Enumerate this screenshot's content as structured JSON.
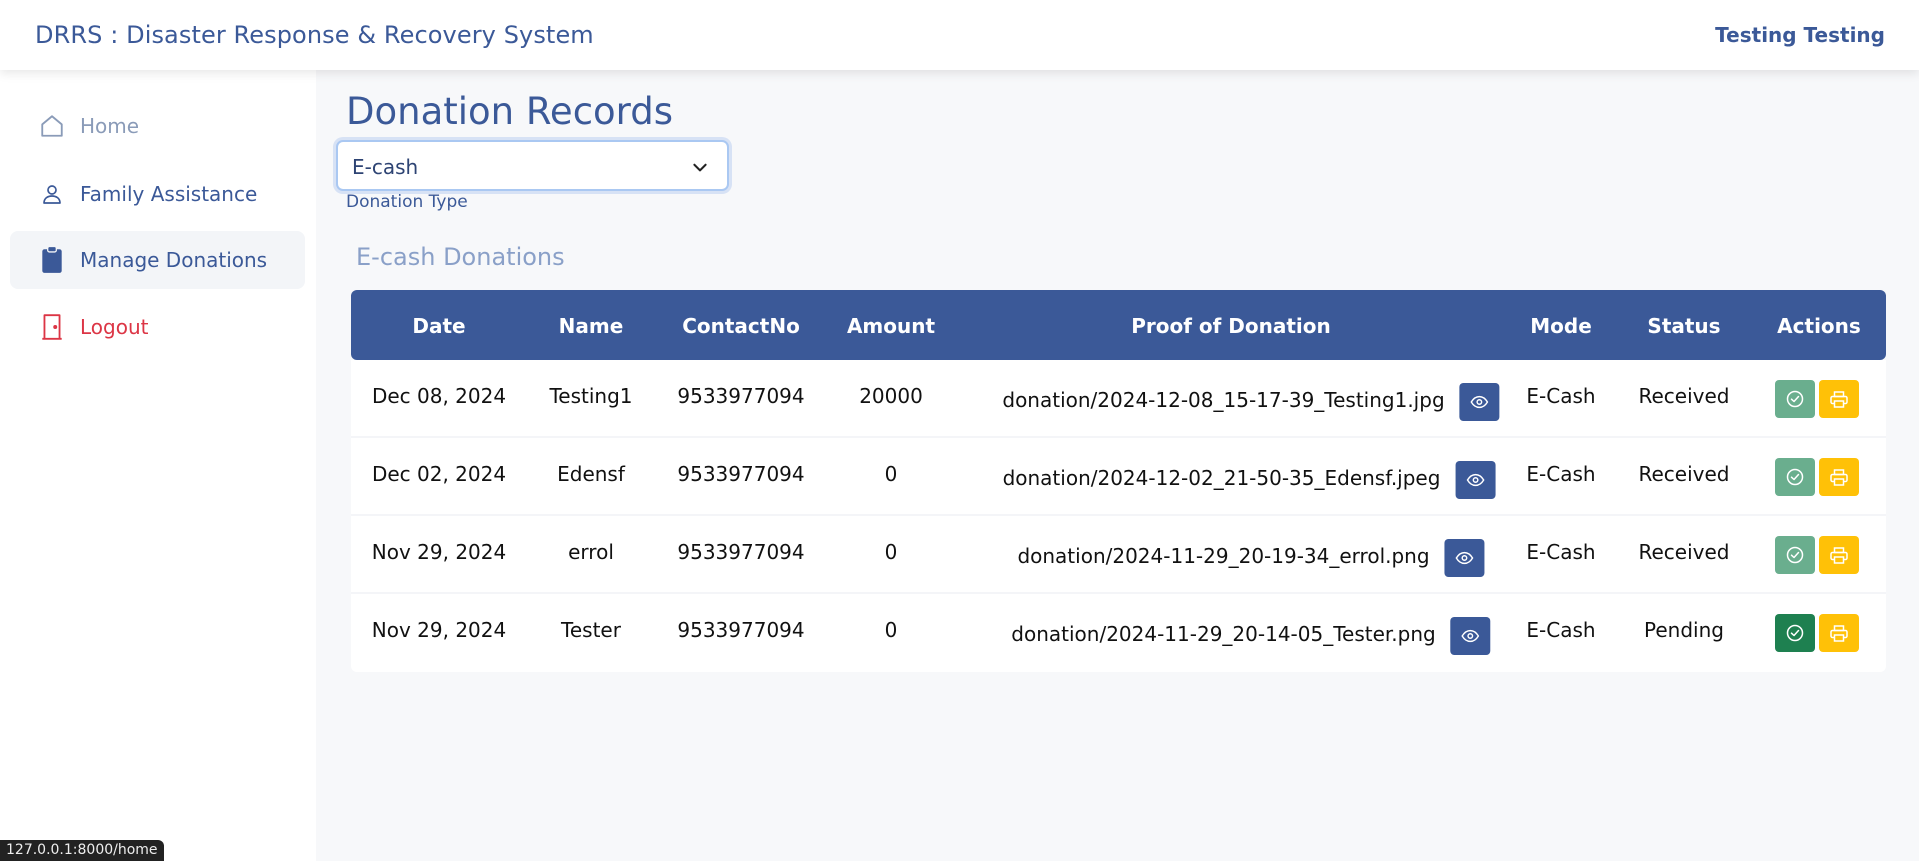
{
  "app": {
    "title": "DRRS : Disaster Response & Recovery System",
    "user": "Testing Testing"
  },
  "sidebar": {
    "items": [
      {
        "label": "Home",
        "icon": "home-icon",
        "color": "#8a9bb8"
      },
      {
        "label": "Family Assistance",
        "icon": "person-icon",
        "color": "#3b5998"
      },
      {
        "label": "Manage Donations",
        "icon": "clipboard-icon",
        "color": "#3b5998",
        "active": true
      },
      {
        "label": "Logout",
        "icon": "logout-icon",
        "color": "#dc3545"
      }
    ]
  },
  "main": {
    "title": "Donation Records",
    "filter": {
      "value": "E-cash",
      "caption": "Donation Type"
    },
    "section_title": "E-cash Donations",
    "table": {
      "headers": [
        "Date",
        "Name",
        "ContactNo",
        "Amount",
        "Proof of Donation",
        "Mode",
        "Status",
        "Actions"
      ],
      "rows": [
        {
          "date": "Dec 08, 2024",
          "name": "Testing1",
          "contact": "9533977094",
          "amount": "20000",
          "proof": "donation/2024-12-08_15-17-39_Testing1.jpg",
          "mode": "E-Cash",
          "status": "Received"
        },
        {
          "date": "Dec 02, 2024",
          "name": "Edensf",
          "contact": "9533977094",
          "amount": "0",
          "proof": "donation/2024-12-02_21-50-35_Edensf.jpeg",
          "mode": "E-Cash",
          "status": "Received"
        },
        {
          "date": "Nov 29, 2024",
          "name": "errol",
          "contact": "9533977094",
          "amount": "0",
          "proof": "donation/2024-11-29_20-19-34_errol.png",
          "mode": "E-Cash",
          "status": "Received"
        },
        {
          "date": "Nov 29, 2024",
          "name": "Tester",
          "contact": "9533977094",
          "amount": "0",
          "proof": "donation/2024-11-29_20-14-05_Tester.png",
          "mode": "E-Cash",
          "status": "Pending"
        }
      ]
    }
  },
  "statusbar": {
    "url": "127.0.0.1:8000/home"
  },
  "colors": {
    "primary": "#3b5998",
    "success": "#198754",
    "warning": "#ffc107",
    "danger": "#dc3545"
  }
}
